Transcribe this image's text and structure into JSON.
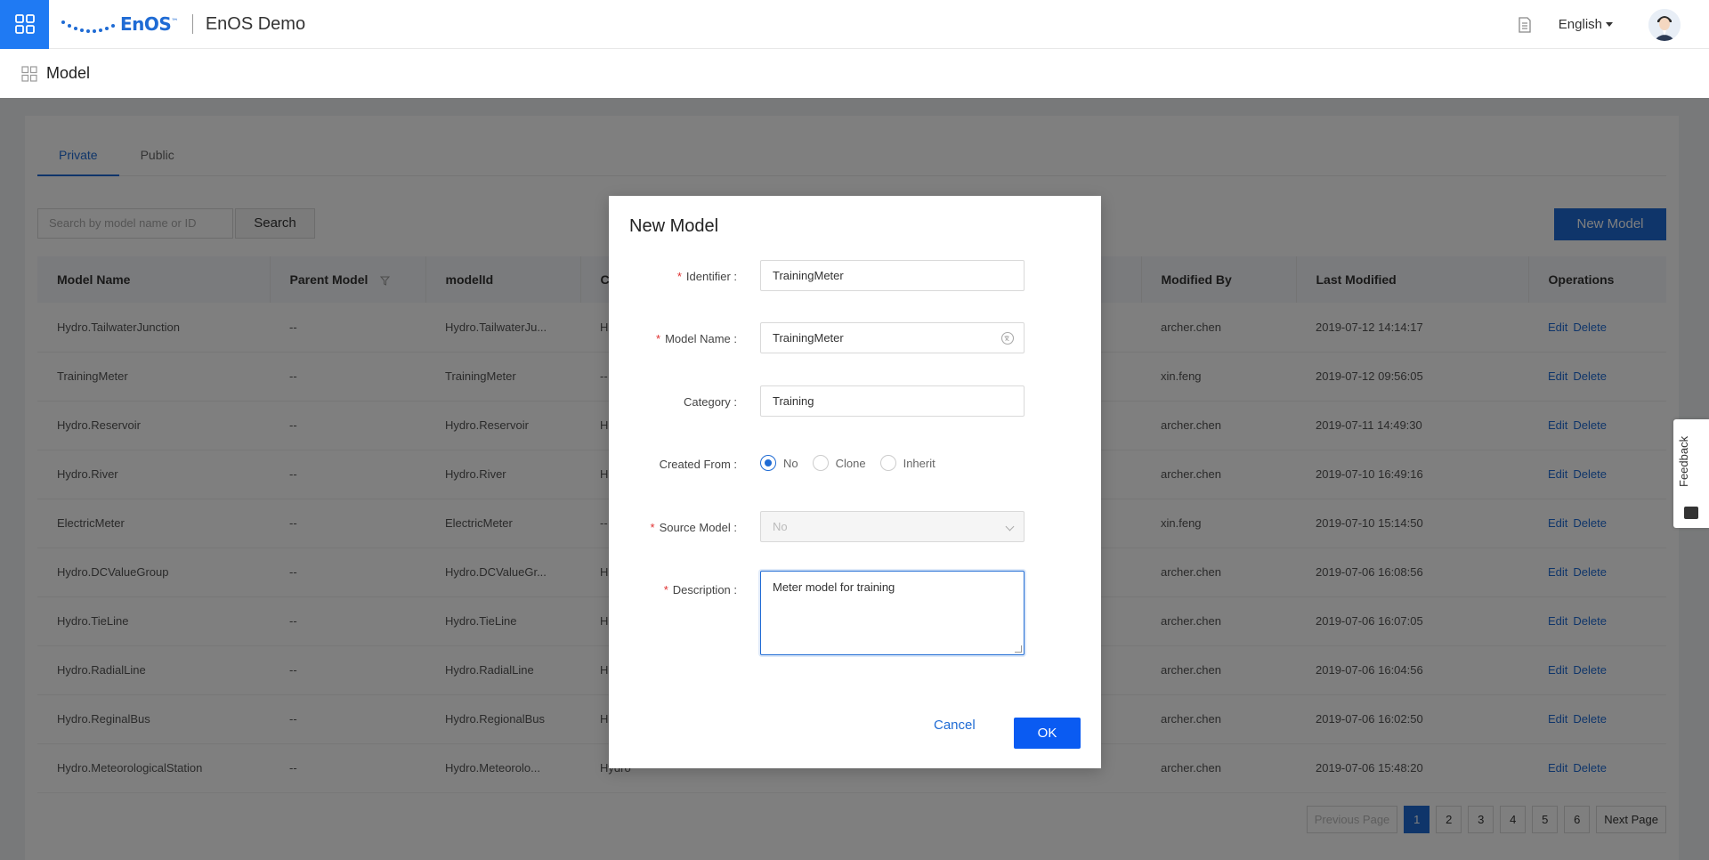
{
  "header": {
    "logo_text": "EnOS",
    "logo_tm": "™",
    "app_title": "EnOS Demo",
    "language": "English"
  },
  "subheader": {
    "page_title": "Model"
  },
  "tabs": [
    {
      "label": "Private",
      "active": true
    },
    {
      "label": "Public",
      "active": false
    }
  ],
  "search": {
    "placeholder": "Search by model name or ID",
    "button_label": "Search"
  },
  "new_model_label": "New Model",
  "table": {
    "columns": [
      "Model Name",
      "Parent Model",
      "modelId",
      "C",
      "",
      "",
      "Modified By",
      "Last Modified",
      "Operations"
    ],
    "rows": [
      {
        "name": "Hydro.TailwaterJunction",
        "parent": "--",
        "model_id": "Hydro.TailwaterJu...",
        "cat": "H",
        "modified_by": "archer.chen",
        "last_modified": "2019-07-12 14:14:17"
      },
      {
        "name": "TrainingMeter",
        "parent": "--",
        "model_id": "TrainingMeter",
        "cat": "--",
        "modified_by": "xin.feng",
        "last_modified": "2019-07-12 09:56:05"
      },
      {
        "name": "Hydro.Reservoir",
        "parent": "--",
        "model_id": "Hydro.Reservoir",
        "cat": "H",
        "modified_by": "archer.chen",
        "last_modified": "2019-07-11 14:49:30"
      },
      {
        "name": "Hydro.River",
        "parent": "--",
        "model_id": "Hydro.River",
        "cat": "H",
        "modified_by": "archer.chen",
        "last_modified": "2019-07-10 16:49:16"
      },
      {
        "name": "ElectricMeter",
        "parent": "--",
        "model_id": "ElectricMeter",
        "cat": "--",
        "modified_by": "xin.feng",
        "last_modified": "2019-07-10 15:14:50"
      },
      {
        "name": "Hydro.DCValueGroup",
        "parent": "--",
        "model_id": "Hydro.DCValueGr...",
        "cat": "H",
        "modified_by": "archer.chen",
        "last_modified": "2019-07-06 16:08:56"
      },
      {
        "name": "Hydro.TieLine",
        "parent": "--",
        "model_id": "Hydro.TieLine",
        "cat": "H",
        "modified_by": "archer.chen",
        "last_modified": "2019-07-06 16:07:05"
      },
      {
        "name": "Hydro.RadialLine",
        "parent": "--",
        "model_id": "Hydro.RadialLine",
        "cat": "H",
        "modified_by": "archer.chen",
        "last_modified": "2019-07-06 16:04:56"
      },
      {
        "name": "Hydro.ReginalBus",
        "parent": "--",
        "model_id": "Hydro.RegionalBus",
        "cat": "H",
        "modified_by": "archer.chen",
        "last_modified": "2019-07-06 16:02:50"
      },
      {
        "name": "Hydro.MeteorologicalStation",
        "parent": "--",
        "model_id": "Hydro.Meteorolo...",
        "cat": "Hydro",
        "modified_by": "archer.chen",
        "last_modified": "2019-07-06 15:48:20"
      }
    ],
    "edit_label": "Edit",
    "delete_label": "Delete"
  },
  "pagination": {
    "prev": "Previous Page",
    "pages": [
      "1",
      "2",
      "3",
      "4",
      "5",
      "6"
    ],
    "next": "Next Page"
  },
  "feedback_label": "Feedback",
  "modal": {
    "title": "New Model",
    "identifier_label": "Identifier :",
    "identifier_value": "TrainingMeter",
    "model_name_label": "Model Name :",
    "model_name_value": "TrainingMeter",
    "category_label": "Category :",
    "category_value": "Training",
    "created_from_label": "Created From :",
    "created_from_options": [
      "No",
      "Clone",
      "Inherit"
    ],
    "created_from_selected": "No",
    "source_model_label": "Source Model :",
    "source_model_value": "No",
    "description_label": "Description :",
    "description_value": "Meter model for training",
    "cancel_label": "Cancel",
    "ok_label": "OK"
  },
  "colors": {
    "accent": "#1f6bd4",
    "header_grid": "#1f7af3",
    "required": "#e03030"
  }
}
